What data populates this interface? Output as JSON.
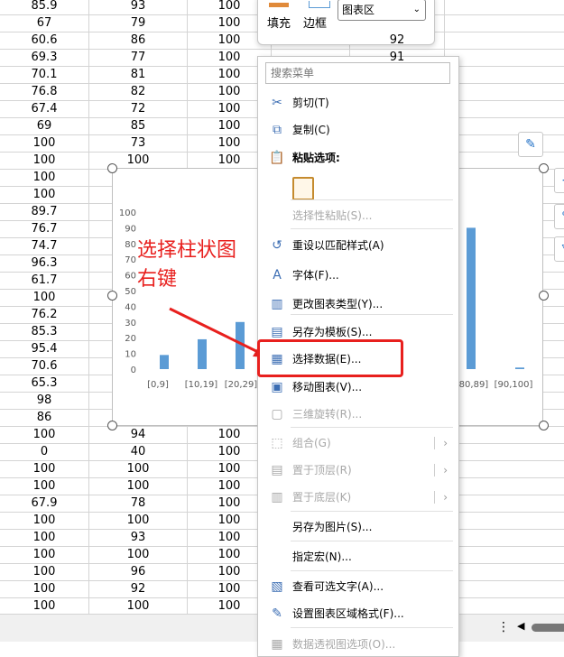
{
  "sheet": {
    "rows": [
      [
        "85.9",
        "93",
        "100",
        "",
        ""
      ],
      [
        "67",
        "79",
        "100",
        "",
        ""
      ],
      [
        "60.6",
        "86",
        "100",
        "",
        ""
      ],
      [
        "69.3",
        "77",
        "100",
        "",
        ""
      ],
      [
        "70.1",
        "81",
        "100",
        "",
        ""
      ],
      [
        "76.8",
        "82",
        "100",
        "",
        ""
      ],
      [
        "67.4",
        "72",
        "100",
        "",
        ""
      ],
      [
        "69",
        "85",
        "100",
        "",
        ""
      ],
      [
        "100",
        "73",
        "100",
        "",
        ""
      ],
      [
        "100",
        "100",
        "100",
        "",
        ""
      ],
      [
        "100",
        "",
        "",
        "",
        ""
      ],
      [
        "100",
        "",
        "",
        "",
        ""
      ],
      [
        "89.7",
        "",
        "",
        "",
        ""
      ],
      [
        "76.7",
        "",
        "",
        "",
        ""
      ],
      [
        "74.7",
        "",
        "",
        "",
        ""
      ],
      [
        "96.3",
        "",
        "",
        "",
        ""
      ],
      [
        "61.7",
        "",
        "",
        "",
        ""
      ],
      [
        "100",
        "",
        "",
        "",
        ""
      ],
      [
        "76.2",
        "",
        "",
        "",
        ""
      ],
      [
        "85.3",
        "",
        "",
        "",
        ""
      ],
      [
        "95.4",
        "",
        "",
        "",
        ""
      ],
      [
        "70.6",
        "",
        "",
        "",
        ""
      ],
      [
        "65.3",
        "",
        "",
        "",
        ""
      ],
      [
        "98",
        "",
        "",
        "",
        ""
      ],
      [
        "86",
        "",
        "",
        "",
        ""
      ],
      [
        "100",
        "94",
        "100",
        "",
        ""
      ],
      [
        "0",
        "40",
        "100",
        "",
        ""
      ],
      [
        "100",
        "100",
        "100",
        "",
        ""
      ],
      [
        "100",
        "100",
        "100",
        "",
        ""
      ],
      [
        "67.9",
        "78",
        "100",
        "",
        ""
      ],
      [
        "100",
        "100",
        "100",
        "",
        ""
      ],
      [
        "100",
        "93",
        "100",
        "",
        ""
      ],
      [
        "100",
        "100",
        "100",
        "",
        ""
      ],
      [
        "100",
        "96",
        "100",
        "",
        ""
      ],
      [
        "100",
        "92",
        "100",
        "",
        ""
      ],
      [
        "100",
        "100",
        "100",
        "",
        ""
      ]
    ],
    "partial_col4": [
      "92",
      "91"
    ]
  },
  "format_toolbar": {
    "fill_label": "填充",
    "border_label": "边框",
    "selector_value": "图表区"
  },
  "chart_data": {
    "type": "bar",
    "categories": [
      "[0,9]",
      "[10,19]",
      "[20,29]",
      "[80,89]",
      "[90,100]"
    ],
    "values": [
      9,
      19,
      30,
      90,
      1
    ],
    "yticks": [
      "100",
      "90",
      "80",
      "70",
      "60",
      "50",
      "40",
      "30",
      "20",
      "10",
      "0"
    ],
    "ylim": [
      0,
      100
    ],
    "bar_color": "#5b9bd5"
  },
  "annotation": {
    "line1": "选择柱状图",
    "line2": "右键"
  },
  "context_menu": {
    "search_placeholder": "搜索菜单",
    "items": [
      {
        "label": "剪切(T)",
        "icon": "scissors-icon",
        "glyph": "✂",
        "disabled": false
      },
      {
        "label": "复制(C)",
        "icon": "copy-icon",
        "glyph": "⧉",
        "disabled": false
      },
      {
        "label": "粘贴选项:",
        "icon": "paste-icon",
        "glyph": "📋",
        "disabled": false
      },
      {
        "label": "选择性粘贴(S)...",
        "icon": "",
        "glyph": "",
        "disabled": true
      },
      {
        "label": "重设以匹配样式(A)",
        "icon": "reset-style-icon",
        "glyph": "↺",
        "disabled": false
      },
      {
        "label": "字体(F)...",
        "icon": "font-icon",
        "glyph": "A",
        "disabled": false
      },
      {
        "label": "更改图表类型(Y)...",
        "icon": "chart-type-icon",
        "glyph": "▥",
        "disabled": false
      },
      {
        "label": "另存为模板(S)...",
        "icon": "save-template-icon",
        "glyph": "▤",
        "disabled": false
      },
      {
        "label": "选择数据(E)...",
        "icon": "select-data-icon",
        "glyph": "▦",
        "disabled": false
      },
      {
        "label": "移动图表(V)...",
        "icon": "move-chart-icon",
        "glyph": "▣",
        "disabled": false
      },
      {
        "label": "三维旋转(R)...",
        "icon": "rotate-3d-icon",
        "glyph": "▢",
        "disabled": true
      },
      {
        "label": "组合(G)",
        "icon": "group-icon",
        "glyph": "⬚",
        "disabled": true
      },
      {
        "label": "置于顶层(R)",
        "icon": "bring-front-icon",
        "glyph": "▤",
        "disabled": true
      },
      {
        "label": "置于底层(K)",
        "icon": "send-back-icon",
        "glyph": "▥",
        "disabled": true
      },
      {
        "label": "另存为图片(S)...",
        "icon": "",
        "glyph": "",
        "disabled": false
      },
      {
        "label": "指定宏(N)...",
        "icon": "",
        "glyph": "",
        "disabled": false
      },
      {
        "label": "查看可选文字(A)...",
        "icon": "alt-text-icon",
        "glyph": "▧",
        "disabled": false
      },
      {
        "label": "设置图表区域格式(F)...",
        "icon": "format-area-icon",
        "glyph": "✎",
        "disabled": false
      },
      {
        "label": "数据透视图选项(O)...",
        "icon": "pivot-options-icon",
        "glyph": "▦",
        "disabled": true
      }
    ]
  },
  "statusbar": {
    "more_glyph": "⋮",
    "scroll_left": "◀"
  }
}
